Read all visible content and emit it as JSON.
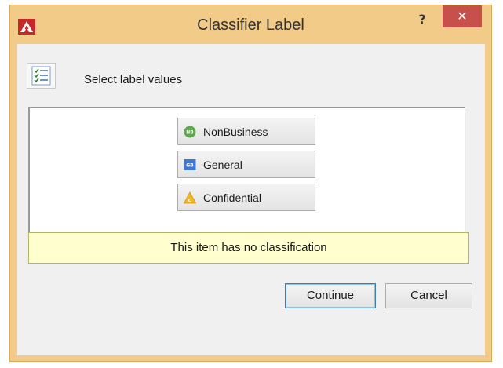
{
  "window": {
    "title": "Classifier Label",
    "help_label": "?",
    "close_label": "✕"
  },
  "header": {
    "icon": "checklist-icon",
    "prompt": "Select label values"
  },
  "labels": [
    {
      "name": "NonBusiness",
      "badge": "NB",
      "icon": "nonbusiness-icon",
      "color": "#5ba84a"
    },
    {
      "name": "General",
      "badge": "GB",
      "icon": "general-icon",
      "color": "#3b78d8"
    },
    {
      "name": "Confidential",
      "badge": "C",
      "icon": "confidential-icon",
      "color": "#f2b620"
    }
  ],
  "status": {
    "message": "This item has no classification"
  },
  "buttons": {
    "continue": "Continue",
    "cancel": "Cancel"
  },
  "colors": {
    "frame": "#f2cb88",
    "close": "#c7504a",
    "status_bg": "#fefece"
  }
}
